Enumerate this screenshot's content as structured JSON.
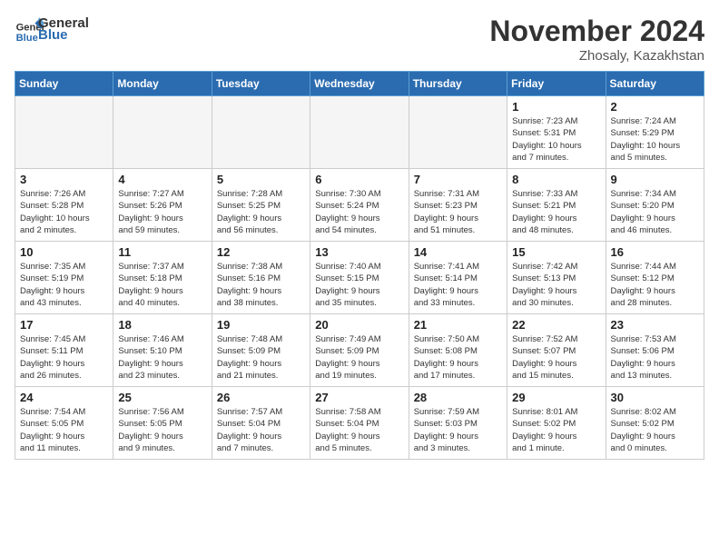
{
  "logo": {
    "line1": "General",
    "line2": "Blue"
  },
  "title": "November 2024",
  "location": "Zhosaly, Kazakhstan",
  "days_of_week": [
    "Sunday",
    "Monday",
    "Tuesday",
    "Wednesday",
    "Thursday",
    "Friday",
    "Saturday"
  ],
  "weeks": [
    [
      {
        "day": "",
        "info": ""
      },
      {
        "day": "",
        "info": ""
      },
      {
        "day": "",
        "info": ""
      },
      {
        "day": "",
        "info": ""
      },
      {
        "day": "",
        "info": ""
      },
      {
        "day": "1",
        "info": "Sunrise: 7:23 AM\nSunset: 5:31 PM\nDaylight: 10 hours\nand 7 minutes."
      },
      {
        "day": "2",
        "info": "Sunrise: 7:24 AM\nSunset: 5:29 PM\nDaylight: 10 hours\nand 5 minutes."
      }
    ],
    [
      {
        "day": "3",
        "info": "Sunrise: 7:26 AM\nSunset: 5:28 PM\nDaylight: 10 hours\nand 2 minutes."
      },
      {
        "day": "4",
        "info": "Sunrise: 7:27 AM\nSunset: 5:26 PM\nDaylight: 9 hours\nand 59 minutes."
      },
      {
        "day": "5",
        "info": "Sunrise: 7:28 AM\nSunset: 5:25 PM\nDaylight: 9 hours\nand 56 minutes."
      },
      {
        "day": "6",
        "info": "Sunrise: 7:30 AM\nSunset: 5:24 PM\nDaylight: 9 hours\nand 54 minutes."
      },
      {
        "day": "7",
        "info": "Sunrise: 7:31 AM\nSunset: 5:23 PM\nDaylight: 9 hours\nand 51 minutes."
      },
      {
        "day": "8",
        "info": "Sunrise: 7:33 AM\nSunset: 5:21 PM\nDaylight: 9 hours\nand 48 minutes."
      },
      {
        "day": "9",
        "info": "Sunrise: 7:34 AM\nSunset: 5:20 PM\nDaylight: 9 hours\nand 46 minutes."
      }
    ],
    [
      {
        "day": "10",
        "info": "Sunrise: 7:35 AM\nSunset: 5:19 PM\nDaylight: 9 hours\nand 43 minutes."
      },
      {
        "day": "11",
        "info": "Sunrise: 7:37 AM\nSunset: 5:18 PM\nDaylight: 9 hours\nand 40 minutes."
      },
      {
        "day": "12",
        "info": "Sunrise: 7:38 AM\nSunset: 5:16 PM\nDaylight: 9 hours\nand 38 minutes."
      },
      {
        "day": "13",
        "info": "Sunrise: 7:40 AM\nSunset: 5:15 PM\nDaylight: 9 hours\nand 35 minutes."
      },
      {
        "day": "14",
        "info": "Sunrise: 7:41 AM\nSunset: 5:14 PM\nDaylight: 9 hours\nand 33 minutes."
      },
      {
        "day": "15",
        "info": "Sunrise: 7:42 AM\nSunset: 5:13 PM\nDaylight: 9 hours\nand 30 minutes."
      },
      {
        "day": "16",
        "info": "Sunrise: 7:44 AM\nSunset: 5:12 PM\nDaylight: 9 hours\nand 28 minutes."
      }
    ],
    [
      {
        "day": "17",
        "info": "Sunrise: 7:45 AM\nSunset: 5:11 PM\nDaylight: 9 hours\nand 26 minutes."
      },
      {
        "day": "18",
        "info": "Sunrise: 7:46 AM\nSunset: 5:10 PM\nDaylight: 9 hours\nand 23 minutes."
      },
      {
        "day": "19",
        "info": "Sunrise: 7:48 AM\nSunset: 5:09 PM\nDaylight: 9 hours\nand 21 minutes."
      },
      {
        "day": "20",
        "info": "Sunrise: 7:49 AM\nSunset: 5:09 PM\nDaylight: 9 hours\nand 19 minutes."
      },
      {
        "day": "21",
        "info": "Sunrise: 7:50 AM\nSunset: 5:08 PM\nDaylight: 9 hours\nand 17 minutes."
      },
      {
        "day": "22",
        "info": "Sunrise: 7:52 AM\nSunset: 5:07 PM\nDaylight: 9 hours\nand 15 minutes."
      },
      {
        "day": "23",
        "info": "Sunrise: 7:53 AM\nSunset: 5:06 PM\nDaylight: 9 hours\nand 13 minutes."
      }
    ],
    [
      {
        "day": "24",
        "info": "Sunrise: 7:54 AM\nSunset: 5:05 PM\nDaylight: 9 hours\nand 11 minutes."
      },
      {
        "day": "25",
        "info": "Sunrise: 7:56 AM\nSunset: 5:05 PM\nDaylight: 9 hours\nand 9 minutes."
      },
      {
        "day": "26",
        "info": "Sunrise: 7:57 AM\nSunset: 5:04 PM\nDaylight: 9 hours\nand 7 minutes."
      },
      {
        "day": "27",
        "info": "Sunrise: 7:58 AM\nSunset: 5:04 PM\nDaylight: 9 hours\nand 5 minutes."
      },
      {
        "day": "28",
        "info": "Sunrise: 7:59 AM\nSunset: 5:03 PM\nDaylight: 9 hours\nand 3 minutes."
      },
      {
        "day": "29",
        "info": "Sunrise: 8:01 AM\nSunset: 5:02 PM\nDaylight: 9 hours\nand 1 minute."
      },
      {
        "day": "30",
        "info": "Sunrise: 8:02 AM\nSunset: 5:02 PM\nDaylight: 9 hours\nand 0 minutes."
      }
    ]
  ]
}
